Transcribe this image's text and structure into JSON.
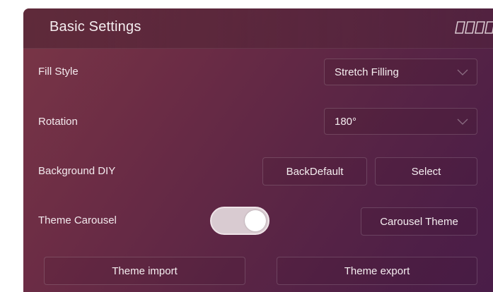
{
  "header": {
    "title": "Basic Settings",
    "icon": "layout-columns-icon"
  },
  "settings": {
    "fill_style": {
      "label": "Fill Style",
      "value": "Stretch Filling"
    },
    "rotation": {
      "label": "Rotation",
      "value": "180°"
    },
    "background_diy": {
      "label": "Background DIY",
      "back_default_label": "BackDefault",
      "select_label": "Select"
    },
    "theme_carousel": {
      "label": "Theme Carousel",
      "toggle_on": true,
      "carousel_theme_label": "Carousel Theme"
    }
  },
  "footer": {
    "theme_import_label": "Theme import",
    "theme_export_label": "Theme export"
  },
  "colors": {
    "panel_start": "#7a3646",
    "panel_end": "#4a1d48",
    "toggle_track": "#d9cbd1"
  }
}
